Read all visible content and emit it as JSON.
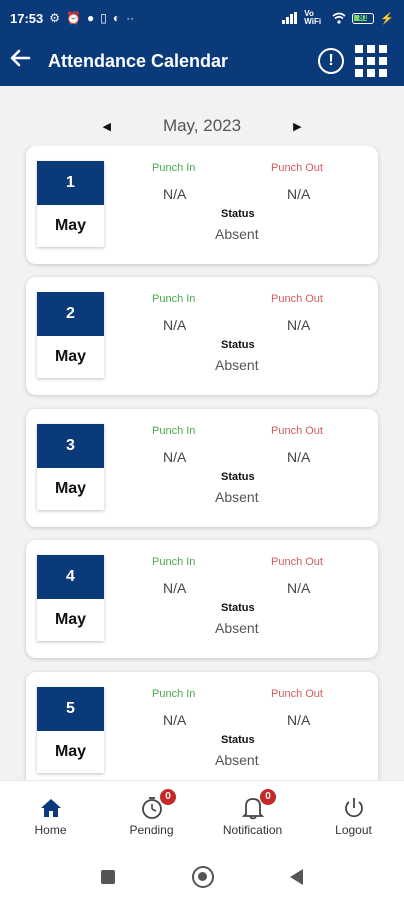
{
  "status_bar": {
    "time": "17:53",
    "left_icons": [
      "settings-icon",
      "alarm-icon",
      "chat-icon",
      "sim-icon",
      "sync-icon",
      "more-dots-icon"
    ],
    "battery": "81",
    "network_label": "Vo WiFi"
  },
  "app_bar": {
    "title": "Attendance Calendar",
    "back_icon": "arrow-left-icon",
    "info_icon": "info-circle-icon",
    "menu_icon": "grid-menu-icon"
  },
  "month_nav": {
    "label": "May, 2023",
    "prev_icon": "caret-left-icon",
    "next_icon": "caret-right-icon"
  },
  "labels": {
    "punch_in": "Punch In",
    "punch_out": "Punch Out",
    "status": "Status"
  },
  "records": [
    {
      "day": "1",
      "month": "May",
      "punch_in": "N/A",
      "punch_out": "N/A",
      "status": "Absent"
    },
    {
      "day": "2",
      "month": "May",
      "punch_in": "N/A",
      "punch_out": "N/A",
      "status": "Absent"
    },
    {
      "day": "3",
      "month": "May",
      "punch_in": "N/A",
      "punch_out": "N/A",
      "status": "Absent"
    },
    {
      "day": "4",
      "month": "May",
      "punch_in": "N/A",
      "punch_out": "N/A",
      "status": "Absent"
    },
    {
      "day": "5",
      "month": "May",
      "punch_in": "N/A",
      "punch_out": "N/A",
      "status": "Absent"
    }
  ],
  "bottom_nav": [
    {
      "label": "Home",
      "icon": "home-icon",
      "badge": null
    },
    {
      "label": "Pending",
      "icon": "timer-icon",
      "badge": "0"
    },
    {
      "label": "Notification",
      "icon": "bell-icon",
      "badge": "0"
    },
    {
      "label": "Logout",
      "icon": "power-icon",
      "badge": null
    }
  ],
  "colors": {
    "primary": "#0b3a7a",
    "punch_in": "#4caa4c",
    "punch_out": "#d65a5a",
    "badge": "#c62828"
  }
}
